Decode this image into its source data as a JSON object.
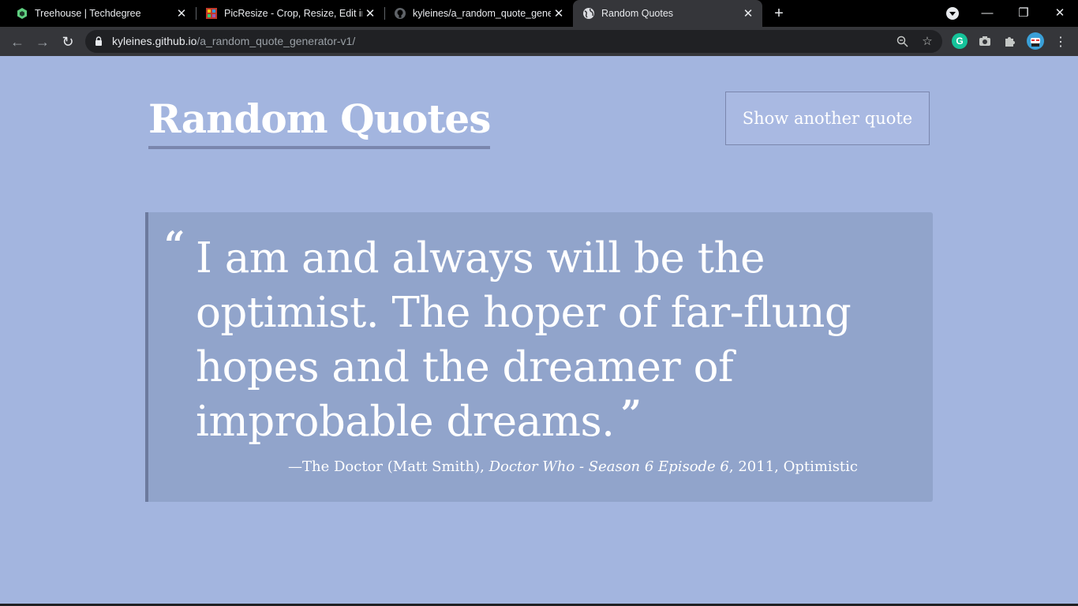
{
  "browser": {
    "tabs": [
      {
        "title": "Treehouse | Techdegree",
        "active": false,
        "favicon": "treehouse-icon"
      },
      {
        "title": "PicResize - Crop, Resize, Edit ima",
        "active": false,
        "favicon": "picresize-icon"
      },
      {
        "title": "kyleines/a_random_quote_genera",
        "active": false,
        "favicon": "github-icon"
      },
      {
        "title": "Random Quotes",
        "active": true,
        "favicon": "globe-icon"
      }
    ],
    "url_host": "kyleines.github.io",
    "url_path": "/a_random_quote_generator-v1/",
    "extension_letter": "G"
  },
  "page": {
    "title": "Random Quotes",
    "button_label": "Show another quote",
    "quote": {
      "open_mark": "“",
      "text": "I am and always will be the optimist. The hoper of far-flung hopes and the dreamer of improbable dreams.",
      "close_mark": "”",
      "source": "—The Doctor (Matt Smith), ",
      "citation": "Doctor Who - Season 6 Episode 6",
      "year": ", 2011, ",
      "tag": "Optimistic"
    }
  },
  "colors": {
    "background": "#a3b5df",
    "quote_box": "#91a4cb",
    "accent_border": "#7a86ad"
  }
}
